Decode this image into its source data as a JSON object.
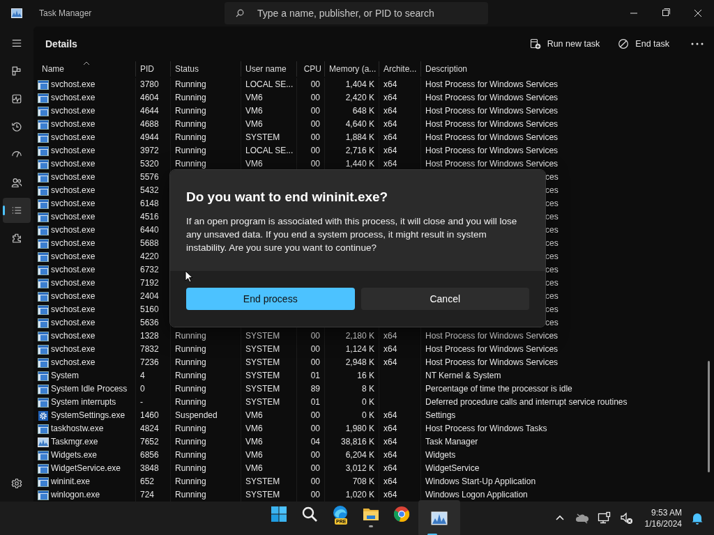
{
  "window": {
    "title": "Task Manager",
    "search_placeholder": "Type a name, publisher, or PID to search"
  },
  "sidebar": {
    "items": [
      {
        "kind": "menu",
        "selected": false
      },
      {
        "kind": "processes",
        "selected": false
      },
      {
        "kind": "performance",
        "selected": false
      },
      {
        "kind": "history",
        "selected": false
      },
      {
        "kind": "startup",
        "selected": false
      },
      {
        "kind": "users",
        "selected": false
      },
      {
        "kind": "details",
        "selected": true
      },
      {
        "kind": "services",
        "selected": false
      }
    ],
    "bottom": {
      "kind": "settings",
      "selected": false
    }
  },
  "header": {
    "title": "Details",
    "actions": [
      {
        "kind": "run",
        "label": "Run new task"
      },
      {
        "kind": "end",
        "label": "End task"
      }
    ]
  },
  "table": {
    "columns": [
      {
        "label": "Name",
        "sorted": true
      },
      {
        "label": "PID",
        "sorted": false
      },
      {
        "label": "Status",
        "sorted": false
      },
      {
        "label": "User name",
        "sorted": false
      },
      {
        "label": "CPU",
        "sorted": false
      },
      {
        "label": "Memory (a...",
        "sorted": false
      },
      {
        "label": "Archite...",
        "sorted": false
      },
      {
        "label": "Description",
        "sorted": false
      }
    ],
    "rows": [
      {
        "kind": "service",
        "name": "svchost.exe",
        "pid": "3780",
        "status": "Running",
        "user": "LOCAL SE...",
        "cpu": "00",
        "memory": "1,404 K",
        "arch": "x64",
        "description": "Host Process for Windows Services"
      },
      {
        "kind": "service",
        "name": "svchost.exe",
        "pid": "4604",
        "status": "Running",
        "user": "VM6",
        "cpu": "00",
        "memory": "2,420 K",
        "arch": "x64",
        "description": "Host Process for Windows Services"
      },
      {
        "kind": "service",
        "name": "svchost.exe",
        "pid": "4644",
        "status": "Running",
        "user": "VM6",
        "cpu": "00",
        "memory": "648 K",
        "arch": "x64",
        "description": "Host Process for Windows Services"
      },
      {
        "kind": "service",
        "name": "svchost.exe",
        "pid": "4688",
        "status": "Running",
        "user": "VM6",
        "cpu": "00",
        "memory": "4,640 K",
        "arch": "x64",
        "description": "Host Process for Windows Services"
      },
      {
        "kind": "service",
        "name": "svchost.exe",
        "pid": "4944",
        "status": "Running",
        "user": "SYSTEM",
        "cpu": "00",
        "memory": "1,884 K",
        "arch": "x64",
        "description": "Host Process for Windows Services"
      },
      {
        "kind": "service",
        "name": "svchost.exe",
        "pid": "3972",
        "status": "Running",
        "user": "LOCAL SE...",
        "cpu": "00",
        "memory": "2,716 K",
        "arch": "x64",
        "description": "Host Process for Windows Services"
      },
      {
        "kind": "service",
        "name": "svchost.exe",
        "pid": "5320",
        "status": "Running",
        "user": "VM6",
        "cpu": "00",
        "memory": "1,440 K",
        "arch": "x64",
        "description": "Host Process for Windows Services"
      },
      {
        "kind": "service",
        "name": "svchost.exe",
        "pid": "5576",
        "description_tail": "ces"
      },
      {
        "kind": "service",
        "name": "svchost.exe",
        "pid": "5432",
        "description_tail": "ces"
      },
      {
        "kind": "service",
        "name": "svchost.exe",
        "pid": "6148",
        "description_tail": "ces"
      },
      {
        "kind": "service",
        "name": "svchost.exe",
        "pid": "4516",
        "description_tail": "ces"
      },
      {
        "kind": "service",
        "name": "svchost.exe",
        "pid": "6440",
        "description_tail": "ces"
      },
      {
        "kind": "service",
        "name": "svchost.exe",
        "pid": "5688",
        "description_tail": "ces"
      },
      {
        "kind": "service",
        "name": "svchost.exe",
        "pid": "4220",
        "description_tail": "ces"
      },
      {
        "kind": "service",
        "name": "svchost.exe",
        "pid": "6732",
        "description_tail": "ces"
      },
      {
        "kind": "service",
        "name": "svchost.exe",
        "pid": "7192",
        "description_tail": "ces"
      },
      {
        "kind": "service",
        "name": "svchost.exe",
        "pid": "2404",
        "description_tail": "ces"
      },
      {
        "kind": "service",
        "name": "svchost.exe",
        "pid": "5160",
        "description_tail": "ces"
      },
      {
        "kind": "service",
        "name": "svchost.exe",
        "pid": "5636",
        "description_tail": "ces"
      },
      {
        "kind": "service",
        "name": "svchost.exe",
        "pid": "1328",
        "status": "Running",
        "user": "SYSTEM",
        "cpu": "00",
        "memory": "2,180 K",
        "arch": "x64",
        "description": "Host Process for Windows Services"
      },
      {
        "kind": "service",
        "name": "svchost.exe",
        "pid": "7832",
        "status": "Running",
        "user": "SYSTEM",
        "cpu": "00",
        "memory": "1,124 K",
        "arch": "x64",
        "description": "Host Process for Windows Services"
      },
      {
        "kind": "service",
        "name": "svchost.exe",
        "pid": "7236",
        "status": "Running",
        "user": "SYSTEM",
        "cpu": "00",
        "memory": "2,948 K",
        "arch": "x64",
        "description": "Host Process for Windows Services"
      },
      {
        "kind": "service",
        "name": "System",
        "pid": "4",
        "status": "Running",
        "user": "SYSTEM",
        "cpu": "01",
        "memory": "16 K",
        "description": "NT Kernel & System"
      },
      {
        "kind": "service",
        "name": "System Idle Process",
        "pid": "0",
        "status": "Running",
        "user": "SYSTEM",
        "cpu": "89",
        "memory": "8 K",
        "description": "Percentage of time the processor is idle"
      },
      {
        "kind": "service",
        "name": "System interrupts",
        "pid": "-",
        "status": "Running",
        "user": "SYSTEM",
        "cpu": "01",
        "memory": "0 K",
        "description": "Deferred procedure calls and interrupt service routines"
      },
      {
        "kind": "settings",
        "name": "SystemSettings.exe",
        "pid": "1460",
        "status": "Suspended",
        "user": "VM6",
        "cpu": "00",
        "memory": "0 K",
        "arch": "x64",
        "description": "Settings"
      },
      {
        "kind": "service",
        "name": "taskhostw.exe",
        "pid": "4824",
        "status": "Running",
        "user": "VM6",
        "cpu": "00",
        "memory": "1,980 K",
        "arch": "x64",
        "description": "Host Process for Windows Tasks"
      },
      {
        "kind": "taskmgr",
        "name": "Taskmgr.exe",
        "pid": "7652",
        "status": "Running",
        "user": "VM6",
        "cpu": "04",
        "memory": "38,816 K",
        "arch": "x64",
        "description": "Task Manager"
      },
      {
        "kind": "service",
        "name": "Widgets.exe",
        "pid": "6856",
        "status": "Running",
        "user": "VM6",
        "cpu": "00",
        "memory": "6,204 K",
        "arch": "x64",
        "description": "Widgets"
      },
      {
        "kind": "service",
        "name": "WidgetService.exe",
        "pid": "3848",
        "status": "Running",
        "user": "VM6",
        "cpu": "00",
        "memory": "3,012 K",
        "arch": "x64",
        "description": "WidgetService"
      },
      {
        "kind": "service",
        "name": "wininit.exe",
        "pid": "652",
        "status": "Running",
        "user": "SYSTEM",
        "cpu": "00",
        "memory": "708 K",
        "arch": "x64",
        "description": "Windows Start-Up Application"
      },
      {
        "kind": "service",
        "name": "winlogon.exe",
        "pid": "724",
        "status": "Running",
        "user": "SYSTEM",
        "cpu": "00",
        "memory": "1,020 K",
        "arch": "x64",
        "description": "Windows Logon Application"
      }
    ]
  },
  "dialog": {
    "title": "Do you want to end wininit.exe?",
    "message": "If an open program is associated with this process, it will close and you will lose any unsaved data. If you end a system process, it might result in system instability. Are you sure you want to continue?",
    "buttons": [
      {
        "label": "End process",
        "primary": true
      },
      {
        "label": "Cancel",
        "primary": false
      }
    ]
  },
  "taskbar": {
    "apps": [
      {
        "kind": "start",
        "running": false,
        "active": false
      },
      {
        "kind": "search",
        "running": false,
        "active": false
      },
      {
        "kind": "edge",
        "badge": "PRE",
        "running": false,
        "active": false
      },
      {
        "kind": "explorer",
        "running": true,
        "active": false
      },
      {
        "kind": "chrome",
        "running": false,
        "active": false
      },
      {
        "kind": "taskmgr",
        "running": true,
        "active": true
      }
    ],
    "tray": [
      {
        "kind": "chevron"
      },
      {
        "kind": "cloud"
      },
      {
        "kind": "network"
      },
      {
        "kind": "volume-muted"
      }
    ],
    "time": "9:53 AM",
    "date": "1/16/2024"
  }
}
